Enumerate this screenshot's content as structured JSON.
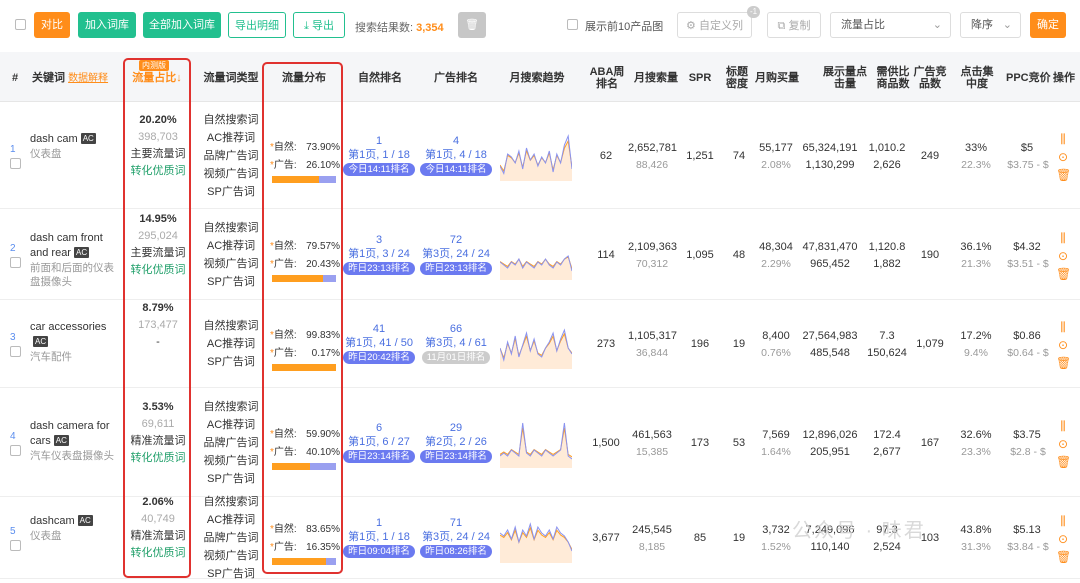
{
  "toolbar": {
    "compare": "对比",
    "add_lib": "加入词库",
    "add_all": "全部加入词库",
    "export_detail": "导出明细",
    "export": "导出",
    "result_label": "搜索结果数:",
    "result_count": "3,354",
    "show_top10": "展示前10产品图",
    "custom_col": "自定义列",
    "copy": "复制",
    "sort_field": "流量占比",
    "sort_order": "降序",
    "confirm": "确定",
    "badge": "-1"
  },
  "headers": {
    "idx": "#",
    "keyword": "关键词",
    "keyword_link": "数据解释",
    "share": "流量占比↓",
    "share_badge": "内测版",
    "type": "流量词类型",
    "dist": "流量分布",
    "organic": "自然排名",
    "ad": "广告排名",
    "trend": "月搜索趋势",
    "aba": "ABA周排名",
    "monthly": "月搜索量",
    "spr": "SPR",
    "title_density": "标题密度",
    "buy": "月购买量",
    "impr": "展示量点击量",
    "supply": "需供比商品数",
    "adcomp": "广告竞品数",
    "click": "点击集中度",
    "ppc": "PPC竞价",
    "ops": "操作"
  },
  "rows": [
    {
      "idx": "1",
      "kw": "dash cam",
      "cn": "仪表盘",
      "share": "20.20%",
      "share_n": "398,703",
      "tag1": "主要流量词",
      "tag2": "转化优质词",
      "types": [
        "自然搜索词",
        "AC推荐词",
        "品牌广告词",
        "视频广告词",
        "SP广告词"
      ],
      "nat": "73.90%",
      "adp": "26.10%",
      "nat_frac": 0.739,
      "o_rank": "1",
      "o_page": "第1页, 1 / 18",
      "o_pill": "今日14:11排名",
      "a_rank": "4",
      "a_page": "第1页, 4 / 18",
      "a_pill": "今日14:11排名",
      "aba": "62",
      "ms": "2,652,781",
      "ms2": "88,426",
      "spr": "1,251",
      "td": "74",
      "buy": "55,177",
      "buy2": "2.08%",
      "imp": "65,324,191",
      "imp2": "1,130,299",
      "sd": "1,010.2",
      "sd2": "2,626",
      "adc": "249",
      "cc": "33%",
      "cc2": "22.3%",
      "ppc": "$5",
      "ppc2": "$3.75 - $"
    },
    {
      "idx": "2",
      "kw": "dash cam front and rear",
      "cn": "前面和后面的仪表盘摄像头",
      "share": "14.95%",
      "share_n": "295,024",
      "tag1": "主要流量词",
      "tag2": "转化优质词",
      "types": [
        "自然搜索词",
        "AC推荐词",
        "视频广告词",
        "SP广告词"
      ],
      "nat": "79.57%",
      "adp": "20.43%",
      "nat_frac": 0.7957,
      "o_rank": "3",
      "o_page": "第1页, 3 / 24",
      "o_pill": "昨日23:13排名",
      "a_rank": "72",
      "a_page": "第3页, 24 / 24",
      "a_pill": "昨日23:13排名",
      "aba": "114",
      "ms": "2,109,363",
      "ms2": "70,312",
      "spr": "1,095",
      "td": "48",
      "buy": "48,304",
      "buy2": "2.29%",
      "imp": "47,831,470",
      "imp2": "965,452",
      "sd": "1,120.8",
      "sd2": "1,882",
      "adc": "190",
      "cc": "36.1%",
      "cc2": "21.3%",
      "ppc": "$4.32",
      "ppc2": "$3.51 - $"
    },
    {
      "idx": "3",
      "kw": "car accessories",
      "cn": "汽车配件",
      "share": "8.79%",
      "share_n": "173,477",
      "tag1": "-",
      "tag2": "",
      "types": [
        "自然搜索词",
        "AC推荐词",
        "SP广告词"
      ],
      "nat": "99.83%",
      "adp": "0.17%",
      "nat_frac": 0.9983,
      "o_rank": "41",
      "o_page": "第1页, 41 / 50",
      "o_pill": "昨日20:42排名",
      "a_rank": "66",
      "a_page": "第3页, 4 / 61",
      "a_pill": "11月01日排名",
      "aba": "273",
      "ms": "1,105,317",
      "ms2": "36,844",
      "spr": "196",
      "td": "19",
      "buy": "8,400",
      "buy2": "0.76%",
      "imp": "27,564,983",
      "imp2": "485,548",
      "sd": "7.3",
      "sd2": "150,624",
      "adc": "1,079",
      "cc": "17.2%",
      "cc2": "9.4%",
      "ppc": "$0.86",
      "ppc2": "$0.64 - $"
    },
    {
      "idx": "4",
      "kw": "dash camera for cars",
      "cn": "汽车仪表盘摄像头",
      "share": "3.53%",
      "share_n": "69,611",
      "tag1": "精准流量词",
      "tag2": "转化优质词",
      "types": [
        "自然搜索词",
        "AC推荐词",
        "品牌广告词",
        "视频广告词",
        "SP广告词"
      ],
      "nat": "59.90%",
      "adp": "40.10%",
      "nat_frac": 0.599,
      "o_rank": "6",
      "o_page": "第1页, 6 / 27",
      "o_pill": "昨日23:14排名",
      "a_rank": "29",
      "a_page": "第2页, 2 / 26",
      "a_pill": "昨日23:14排名",
      "aba": "1,500",
      "ms": "461,563",
      "ms2": "15,385",
      "spr": "173",
      "td": "53",
      "buy": "7,569",
      "buy2": "1.64%",
      "imp": "12,896,026",
      "imp2": "205,951",
      "sd": "172.4",
      "sd2": "2,677",
      "adc": "167",
      "cc": "32.6%",
      "cc2": "23.3%",
      "ppc": "$3.75",
      "ppc2": "$2.8 - $"
    },
    {
      "idx": "5",
      "kw": "dashcam",
      "cn": "仪表盘",
      "share": "2.06%",
      "share_n": "40,749",
      "tag1": "精准流量词",
      "tag2": "转化优质词",
      "types": [
        "自然搜索词",
        "AC推荐词",
        "品牌广告词",
        "视频广告词",
        "SP广告词"
      ],
      "nat": "83.65%",
      "adp": "16.35%",
      "nat_frac": 0.8365,
      "o_rank": "1",
      "o_page": "第1页, 1 / 18",
      "o_pill": "昨日09:04排名",
      "a_rank": "71",
      "a_page": "第3页, 24 / 24",
      "a_pill": "昨日08:26排名",
      "aba": "3,677",
      "ms": "245,545",
      "ms2": "8,185",
      "spr": "85",
      "td": "19",
      "buy": "3,732",
      "buy2": "1.52%",
      "imp": "7,249,096",
      "imp2": "110,140",
      "sd": "97.3",
      "sd2": "2,524",
      "adc": "103",
      "cc": "43.8%",
      "cc2": "31.3%",
      "ppc": "$5.13",
      "ppc2": "$3.84 - $"
    }
  ],
  "watermark": "公众号 · 味君",
  "colors": {
    "accent": "#ff8d1a",
    "green": "#22c08f",
    "highlight": "#e0322f",
    "pill": "#6b7af0"
  }
}
